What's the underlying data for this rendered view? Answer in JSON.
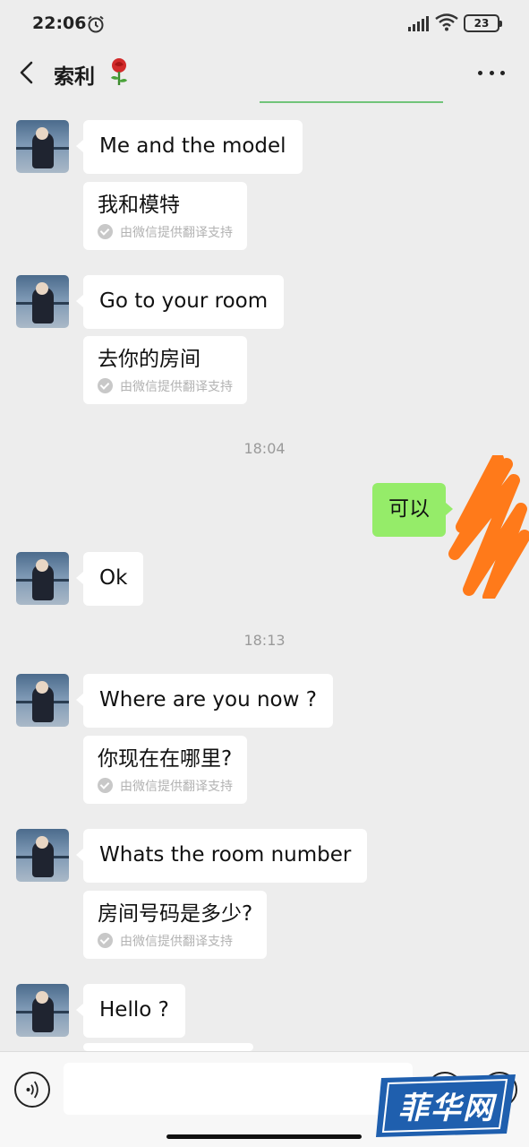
{
  "status_bar": {
    "time": "22:06",
    "battery": "23"
  },
  "header": {
    "title": "索利"
  },
  "messages": [
    {
      "text": "Me and the model",
      "translation": "我和模特",
      "credit": "由微信提供翻译支持"
    },
    {
      "text": "Go to your room",
      "translation": "去你的房间",
      "credit": "由微信提供翻译支持"
    },
    {
      "timestamp": "18:04"
    },
    {
      "self_text": "可以"
    },
    {
      "text": "Ok"
    },
    {
      "timestamp": "18:13"
    },
    {
      "text": "Where are you now ?",
      "translation": "你现在在哪里?",
      "credit": "由微信提供翻译支持"
    },
    {
      "text": "Whats the room number",
      "translation": "房间号码是多少?",
      "credit": "由微信提供翻译支持"
    },
    {
      "text": "Hello ?"
    }
  ],
  "watermark": {
    "logo_text": "菲华网"
  },
  "colors": {
    "background": "#ededed",
    "self_bubble": "#95ec69",
    "other_bubble": "#ffffff",
    "scribble": "#ff7a1a"
  }
}
